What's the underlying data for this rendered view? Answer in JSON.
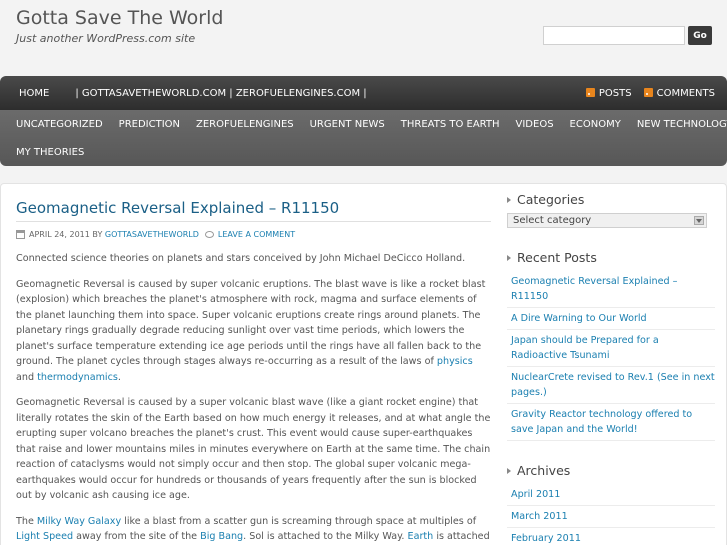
{
  "header": {
    "title": "Gotta Save The World",
    "description": "Just another WordPress.com site",
    "search_placeholder": "",
    "search_button": "Go"
  },
  "topnav": {
    "items": [
      {
        "label": "Home"
      },
      {
        "label": "| gottasavetheworld.com | zerofuelengines.com |"
      }
    ],
    "feeds": [
      {
        "label": "Posts",
        "icon": "rss-icon"
      },
      {
        "label": "Comments",
        "icon": "rss-icon"
      }
    ]
  },
  "catnav": {
    "row1": [
      "Uncategorized",
      "Prediction",
      "zerofuelengines",
      "Urgent News",
      "Threats to Earth",
      "Videos",
      "Economy",
      "New Technology"
    ],
    "row2": [
      "My Theories"
    ]
  },
  "post": {
    "title": "Geomagnetic Reversal Explained – R11150",
    "date": "April 24, 2011",
    "by": "by",
    "author": "gottasavetheworld",
    "leave_comment": "Leave a comment",
    "p1": "Connected science theories on planets and stars conceived by John Michael DeCicco Holland.",
    "p2_text": "Geomagnetic Reversal is caused by super volcanic eruptions. The blast wave is like a rocket blast (explosion) which breaches the planet's atmosphere with rock, magma and surface elements of the planet launching them into space. Super volcanic eruptions create rings around planets. The planetary rings gradually degrade reducing sunlight over vast time periods, which lowers the planet's surface temperature extending ice age periods until the rings have all fallen back to the ground. The planet cycles through stages always re-occurring as a result of the laws of",
    "p2_link1": "physics",
    "p2_and": "and",
    "p2_link2": "thermodynamics",
    "p2_end": ".",
    "p3": "Geomagnetic Reversal is caused by a super volcanic blast wave  (like a giant rocket engine) that literally rotates the skin of the Earth based on how much energy it releases, and at what angle the erupting super volcano breaches the planet's crust. This event would cause super-earthquakes that raise and lower mountains miles in minutes everywhere on Earth at the same time. The chain reaction of cataclysms would not simply occur and then stop. The global super volcanic mega-earthquakes would occur for hundreds or thousands of years frequently after the sun is blocked out by volcanic ash causing ice age.",
    "p4_the": "The",
    "p4_link1": "Milky Way Galaxy",
    "p4_text1": " like a blast from a scatter gun is screaming through space at multiples of",
    "p4_link2": "Light Speed",
    "p4_text2": "away from the site of the",
    "p4_link3": "Big Bang",
    "p4_text3": ". Sol is attached to the  Milky Way.",
    "p4_link4": "Earth",
    "p4_text4": "is attached"
  },
  "sidebar": {
    "categories_title": "Categories",
    "category_select": "Select category",
    "recent_title": "Recent Posts",
    "recent_posts": [
      "Geomagnetic Reversal Explained – R11150",
      "A Dire Warning to Our World",
      "Japan should be Prepared for a Radioactive Tsunami",
      "NuclearCrete revised to Rev.1 (See in next pages.)",
      "Gravity Reactor technology offered to save Japan and the World!"
    ],
    "archives_title": "Archives",
    "archives": [
      "April 2011",
      "March 2011",
      "February 2011"
    ]
  }
}
